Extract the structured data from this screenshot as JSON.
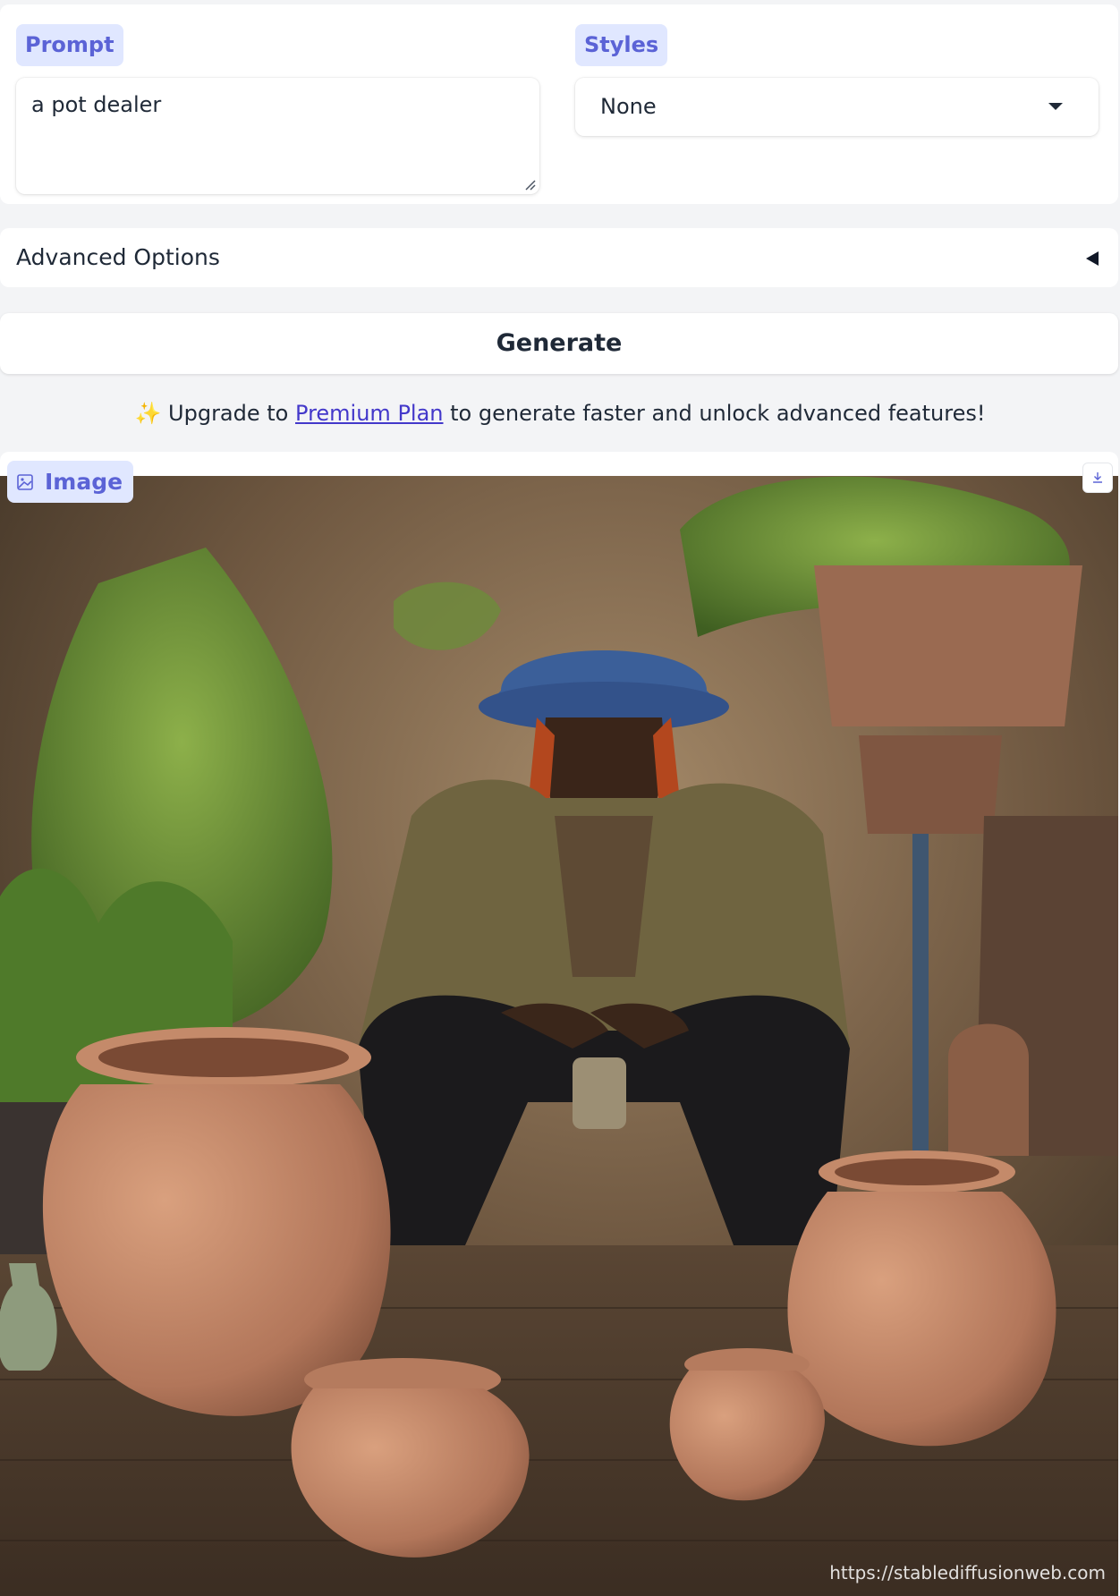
{
  "prompt": {
    "label": "Prompt",
    "value": "a pot dealer"
  },
  "styles": {
    "label": "Styles",
    "selected": "None"
  },
  "advanced": {
    "label": "Advanced Options"
  },
  "generate": {
    "label": "Generate"
  },
  "upgrade": {
    "icon": "sparkles-icon",
    "emoji": "✨",
    "before": "Upgrade to",
    "link": "Premium Plan",
    "after": "to generate faster and unlock advanced features!"
  },
  "output": {
    "label": "Image",
    "watermark": "https://stablediffusionweb.com"
  },
  "colors": {
    "accent": "#5b63d6",
    "badge_bg": "#e0e7ff",
    "link": "#4338ca"
  }
}
